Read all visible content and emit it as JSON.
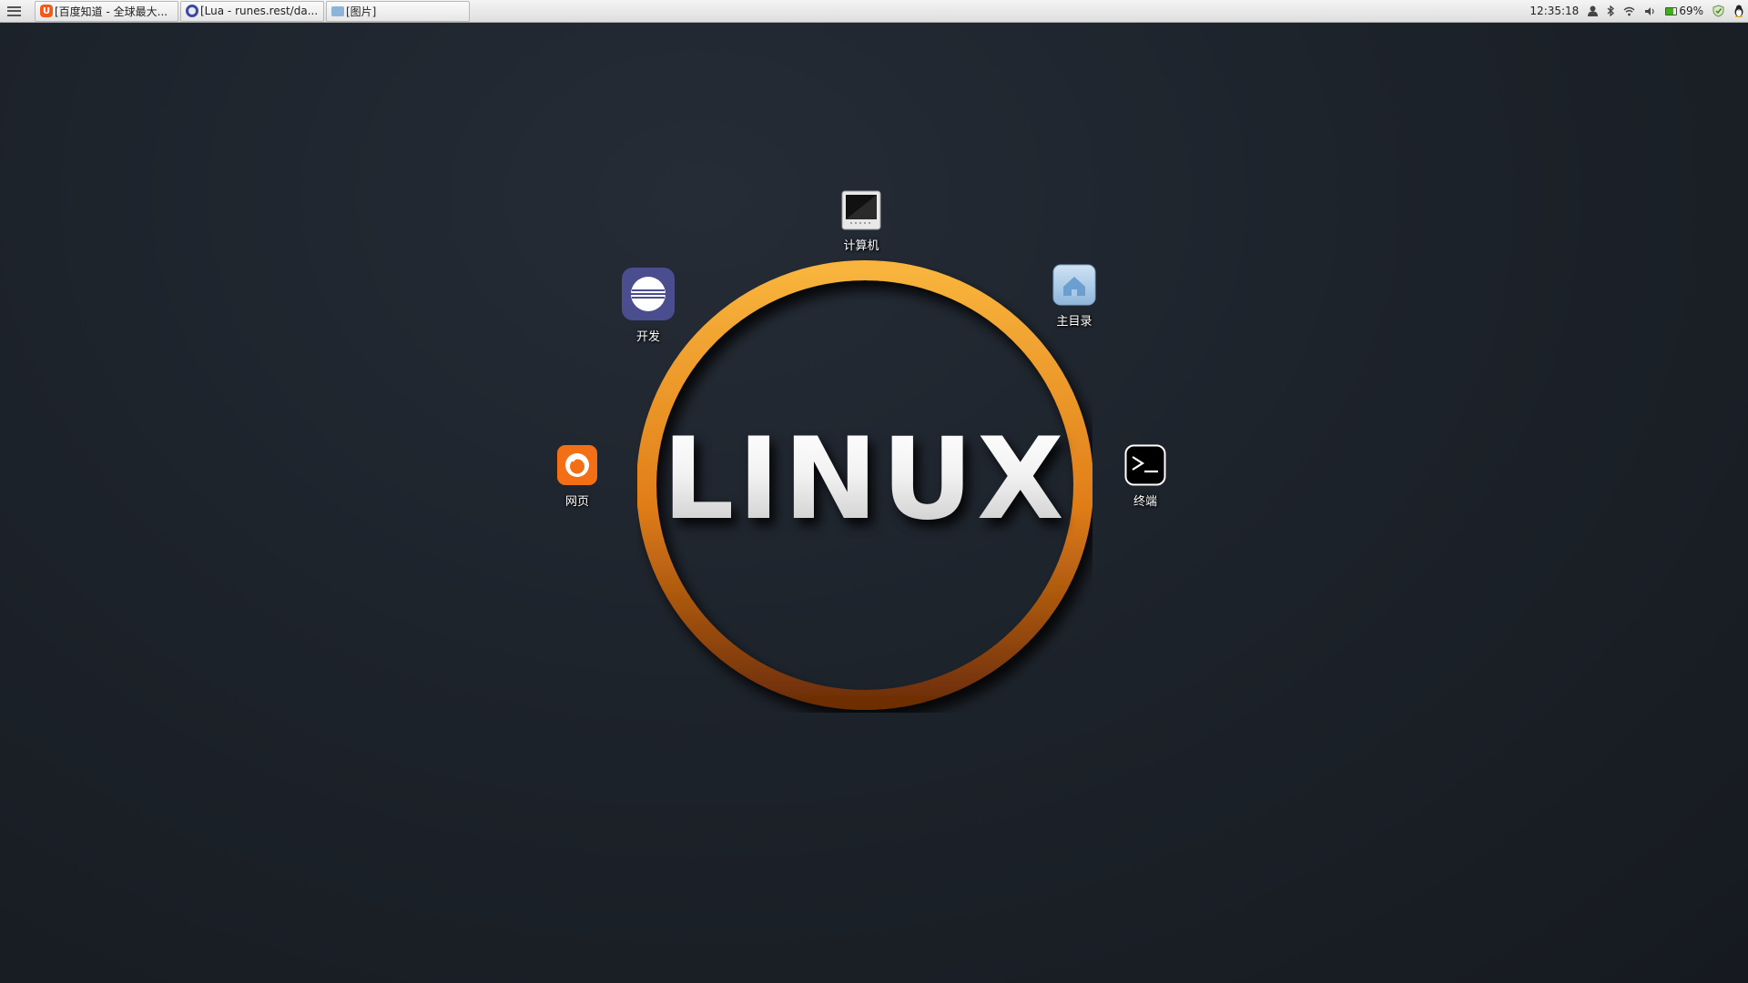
{
  "panel": {
    "tasks": [
      {
        "label": "[百度知道 - 全球最大...",
        "icon": "baidu-icon"
      },
      {
        "label": "[Lua - runes.rest/da...",
        "icon": "lua-icon"
      },
      {
        "label": "[图片]",
        "icon": "folder-icon"
      }
    ],
    "tray": {
      "clock": "12:35:18",
      "battery_percent": "69%",
      "battery_level": 0.69
    }
  },
  "desktop": {
    "logo_text": "LINUX",
    "icons": [
      {
        "label": "计算机",
        "icon": "computer-icon"
      },
      {
        "label": "开发",
        "icon": "eclipse-icon"
      },
      {
        "label": "主目录",
        "icon": "home-folder-icon"
      },
      {
        "label": "网页",
        "icon": "firefox-icon"
      },
      {
        "label": "终端",
        "icon": "terminal-icon"
      }
    ]
  },
  "colors": {
    "ring_top": "#f8b43c",
    "ring_bottom": "#6e2e06",
    "firefox": "#f36f15",
    "eclipse": "#4a4d8e"
  }
}
